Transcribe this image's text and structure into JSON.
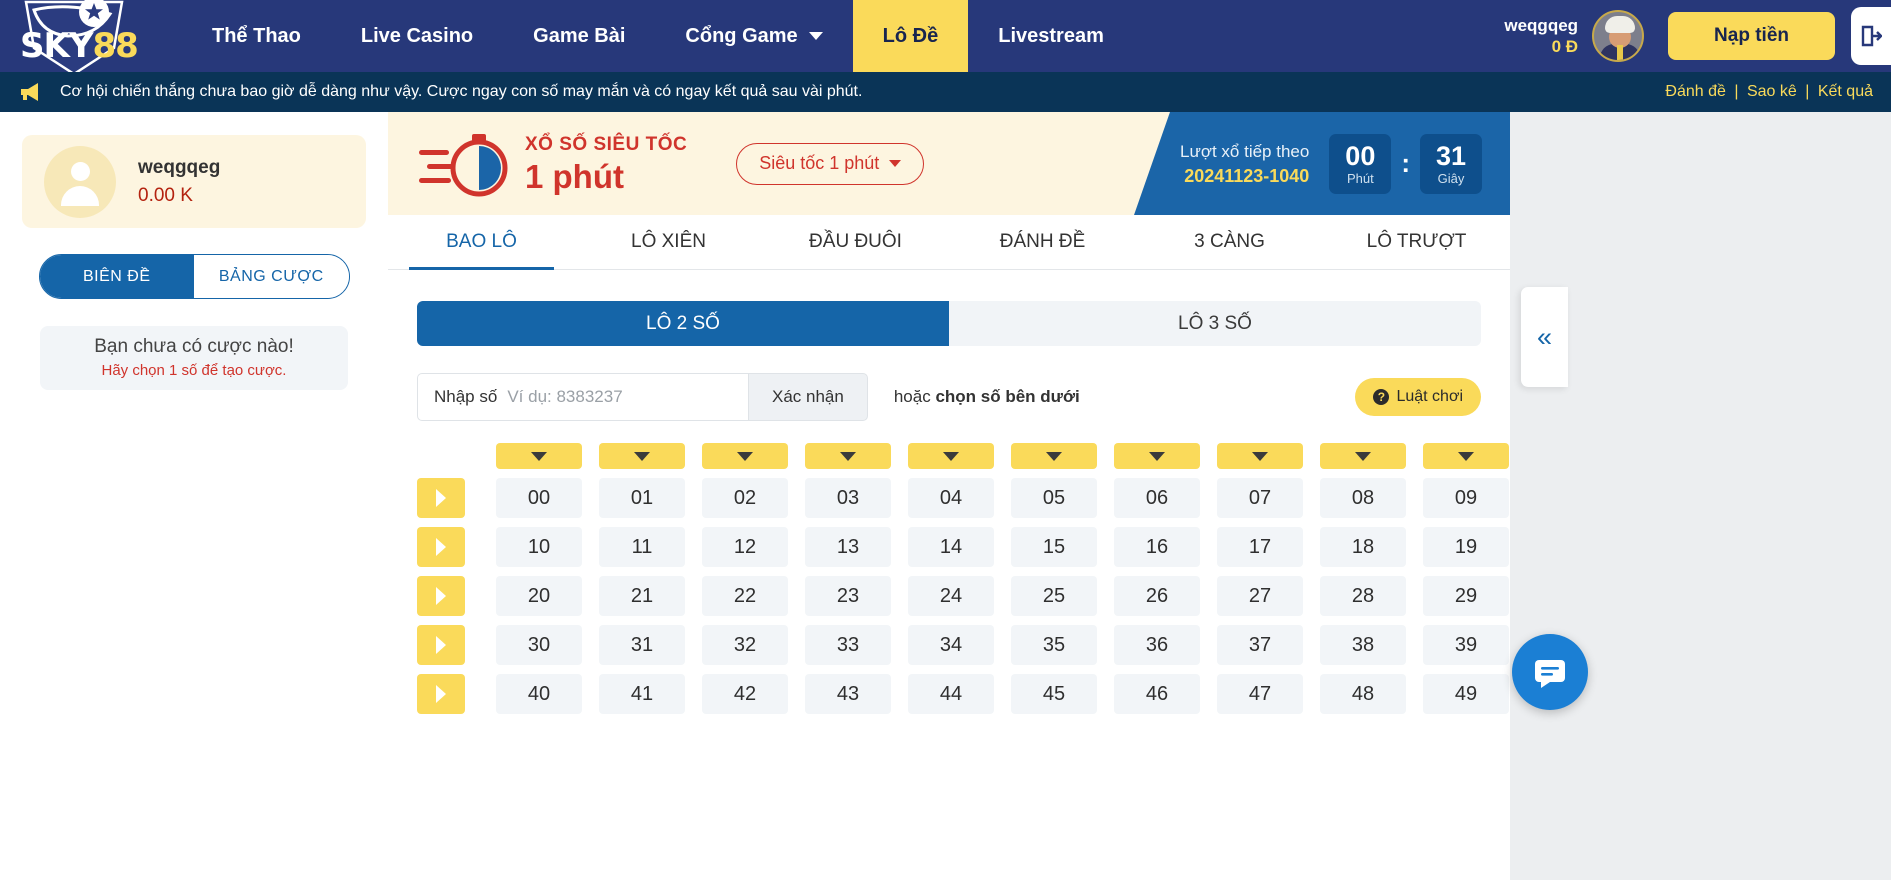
{
  "brand": {
    "name_part1": "SKY",
    "name_part2": "88",
    "logo_icon": "sky88-shield-logo"
  },
  "header": {
    "nav": [
      {
        "label": "Thể Thao",
        "active": false,
        "has_caret": false
      },
      {
        "label": "Live Casino",
        "active": false,
        "has_caret": false
      },
      {
        "label": "Game Bài",
        "active": false,
        "has_caret": false
      },
      {
        "label": "Cổng Game",
        "active": false,
        "has_caret": true
      },
      {
        "label": "Lô Đề",
        "active": true,
        "has_caret": false
      },
      {
        "label": "Livestream",
        "active": false,
        "has_caret": false
      }
    ],
    "user": {
      "name": "weqgqeg",
      "balance": "0 Đ"
    },
    "deposit_label": "Nạp tiền",
    "logout_icon": "logout-icon",
    "accent_yellow": "#fada5a",
    "nav_bg": "#27387a"
  },
  "announce": {
    "icon": "megaphone-icon",
    "text": "Cơ hội chiến thắng chưa bao giờ dễ dàng như vậy. Cược ngay con số may mắn và có ngay kết quả sau vài phút.",
    "links": [
      "Đánh đề",
      "Sao kê",
      "Kết quả"
    ],
    "separator": "|",
    "bg": "#0a3457",
    "link_color": "#fada5a"
  },
  "sidebar": {
    "user_card": {
      "avatar_icon": "user-avatar-icon",
      "name": "weqgqeg",
      "balance": "0.00 K"
    },
    "segments": [
      {
        "label": "BIÊN ĐỀ",
        "active": true
      },
      {
        "label": "BẢNG CƯỢC",
        "active": false
      }
    ],
    "empty_state": {
      "line1": "Bạn chưa có cược nào!",
      "line2": "Hãy chọn 1 số để tạo cược."
    }
  },
  "lottery": {
    "clock_icon": "speed-clock-icon",
    "title_small": "XỔ SỐ SIÊU TỐC",
    "title_big": "1 phút",
    "speed_select": {
      "value": "Siêu tốc 1 phút",
      "caret_icon": "chevron-down-icon"
    },
    "draw": {
      "label": "Lượt xổ tiếp theo",
      "draw_id": "20241123-1040",
      "minutes": "00",
      "minutes_label": "Phút",
      "colon": ":",
      "seconds": "31",
      "seconds_label": "Giây"
    }
  },
  "main_tabs": [
    {
      "label": "BAO LÔ",
      "active": true
    },
    {
      "label": "LÔ XIÊN",
      "active": false
    },
    {
      "label": "ĐẦU ĐUÔI",
      "active": false
    },
    {
      "label": "ĐÁNH ĐỀ",
      "active": false
    },
    {
      "label": "3 CÀNG",
      "active": false
    },
    {
      "label": "LÔ TRƯỢT",
      "active": false
    }
  ],
  "sub_tabs": [
    {
      "label": "LÔ 2 SỐ",
      "active": true
    },
    {
      "label": "LÔ 3 SỐ",
      "active": false
    }
  ],
  "bet_input": {
    "label": "Nhập số",
    "placeholder": "Ví dụ: 8383237",
    "value": "",
    "confirm_label": "Xác nhận",
    "or_prefix": "hoặc ",
    "or_bold": "chọn số bên dưới",
    "rule_label": "Luật chơi",
    "rule_icon": "question-mark-icon"
  },
  "number_grid": {
    "column_selector_icon": "chevron-down-icon",
    "row_selector_icon": "chevron-right-icon",
    "columns": 10,
    "rows": [
      [
        "00",
        "01",
        "02",
        "03",
        "04",
        "05",
        "06",
        "07",
        "08",
        "09"
      ],
      [
        "10",
        "11",
        "12",
        "13",
        "14",
        "15",
        "16",
        "17",
        "18",
        "19"
      ],
      [
        "20",
        "21",
        "22",
        "23",
        "24",
        "25",
        "26",
        "27",
        "28",
        "29"
      ],
      [
        "30",
        "31",
        "32",
        "33",
        "34",
        "35",
        "36",
        "37",
        "38",
        "39"
      ],
      [
        "40",
        "41",
        "42",
        "43",
        "44",
        "45",
        "46",
        "47",
        "48",
        "49"
      ]
    ]
  },
  "right_panel": {
    "collapse_icon": "double-chevron-left-icon",
    "collapse_glyph": "«",
    "chat_icon": "chat-bubble-icon"
  }
}
